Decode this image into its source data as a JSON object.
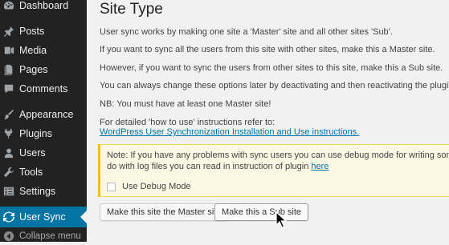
{
  "sidebar": {
    "items": [
      {
        "label": "Dashboard",
        "icon": "dashboard-icon"
      },
      {
        "label": "Posts",
        "icon": "pin-icon"
      },
      {
        "label": "Media",
        "icon": "media-icon"
      },
      {
        "label": "Pages",
        "icon": "pages-icon"
      },
      {
        "label": "Comments",
        "icon": "comments-icon"
      },
      {
        "label": "Appearance",
        "icon": "paintbrush-icon"
      },
      {
        "label": "Plugins",
        "icon": "plugin-icon"
      },
      {
        "label": "Users",
        "icon": "users-icon"
      },
      {
        "label": "Tools",
        "icon": "wrench-icon"
      },
      {
        "label": "Settings",
        "icon": "settings-icon"
      },
      {
        "label": "User Sync",
        "icon": "sync-icon",
        "active": true
      }
    ],
    "collapse_label": "Collapse menu"
  },
  "main": {
    "title": "Site Type",
    "paragraphs": [
      "User sync works by making one site a 'Master' site and all other sites 'Sub'.",
      "If you want to sync all the users from this site with other sites, make this a Master site.",
      "However, if you want to sync the users from other sites to this site, make this a Sub site.",
      "You can always change these options later by deactivating and then reactivating the plugin.",
      "NB: You must have at least one Master site!"
    ],
    "howto_text": "For detailed 'how to use' instructions refer to:",
    "howto_link": "WordPress User Synchronization Installation and Use instructions."
  },
  "notice": {
    "line1": "Note: If you have any problems with sync users you can use debug mode for writing some operation",
    "line2": "do with log files you can read in instruction of plugin",
    "link": "here",
    "debug_label": "Use Debug Mode",
    "debug_checked": false
  },
  "buttons": {
    "master": "Make this site the Master site",
    "sub": "Make this a Sub site"
  },
  "colors": {
    "sidebar_bg": "#222222",
    "active_bg": "#0074a2",
    "link": "#0074a2",
    "notice_bg": "#fcf8e3",
    "notice_border": "#ffba00"
  }
}
